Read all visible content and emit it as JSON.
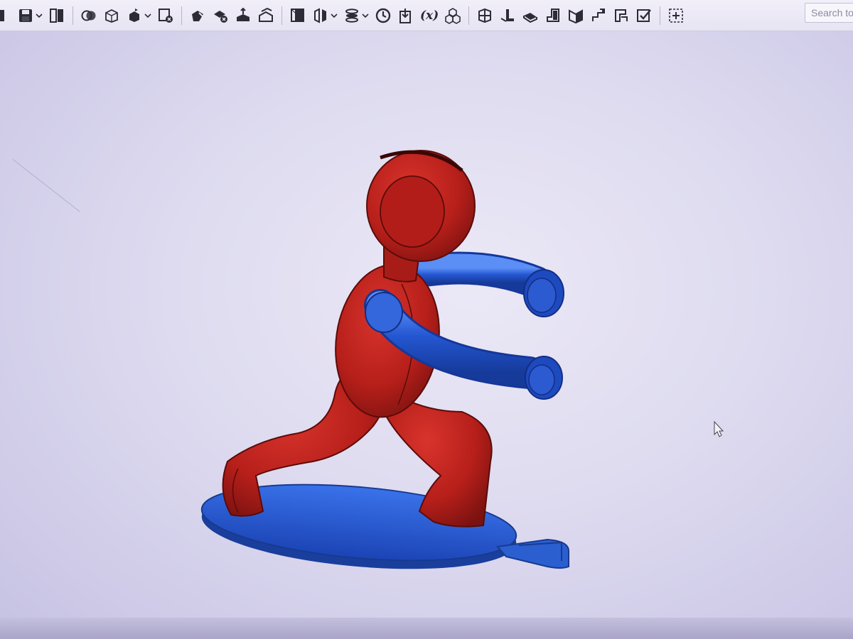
{
  "toolbar": {
    "icons": [
      "cut-edge-icon",
      "save-icon",
      "parts-panel-icon",
      "boolean-icon",
      "shell-icon",
      "transform-icon",
      "delete-part-icon",
      "split-icon",
      "delete-face-icon",
      "extrude-face-icon",
      "offset-surface-icon",
      "plane-icon",
      "mirror-icon",
      "pattern-icon",
      "history-icon",
      "import-icon",
      "variable-icon",
      "assembly-icon",
      "sheet-metal-icon",
      "flange-icon",
      "hem-icon",
      "tab-icon",
      "bend-icon",
      "corner-icon",
      "joint-icon",
      "finish-icon",
      "add-custom-icon"
    ],
    "variable_label": "(x)",
    "search": {
      "placeholder": "Search tools"
    }
  },
  "viewport": {
    "model": {
      "figure_color": "#c0221e",
      "arms_color": "#1f4fc9",
      "base_color": "#2a63d6"
    }
  },
  "colors": {
    "background": "#dcd8ef",
    "toolbar": "#ebe9f5"
  }
}
